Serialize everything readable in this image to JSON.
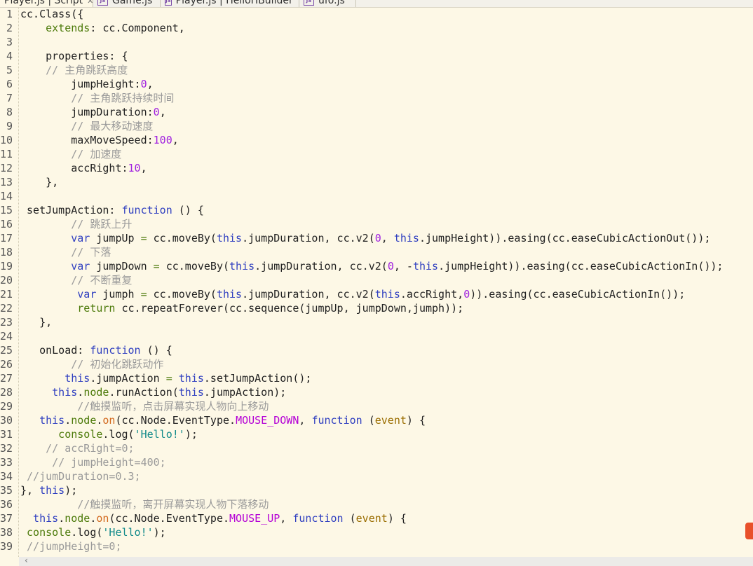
{
  "tabs": [
    {
      "label": "Player.js | Script",
      "active": true,
      "icon": "js-file-icon"
    },
    {
      "label": "Game.js",
      "icon": "js-file-icon"
    },
    {
      "label": "Player.js | HelloHBuilder",
      "icon": "js-file-icon"
    },
    {
      "label": "ufo.js",
      "icon": "js-file-icon"
    }
  ],
  "tab_icon_text": "JS",
  "tab_close": "✕",
  "scroll_left": "‹",
  "colors": {
    "background": "#fdf8e6",
    "keyword": "#2f3fc0",
    "number": "#a020e0",
    "string": "#118a8a",
    "comment": "#9a9a9a"
  },
  "code": {
    "lines": [
      {
        "n": "1",
        "t": [
          [
            "p",
            "cc.Class({"
          ]
        ]
      },
      {
        "n": "2",
        "t": [
          [
            "p",
            "    "
          ],
          [
            "g",
            "extends"
          ],
          [
            "p",
            ": cc.Component,"
          ]
        ]
      },
      {
        "n": "3",
        "t": []
      },
      {
        "n": "4",
        "t": [
          [
            "p",
            "    properties: {"
          ]
        ]
      },
      {
        "n": "5",
        "t": [
          [
            "c",
            "    // 主角跳跃高度"
          ]
        ]
      },
      {
        "n": "6",
        "t": [
          [
            "p",
            "        jumpHeight:"
          ],
          [
            "n",
            "0"
          ],
          [
            "p",
            ","
          ]
        ]
      },
      {
        "n": "7",
        "t": [
          [
            "c",
            "        // 主角跳跃持续时间"
          ]
        ]
      },
      {
        "n": "8",
        "t": [
          [
            "p",
            "        jumpDuration:"
          ],
          [
            "n",
            "0"
          ],
          [
            "p",
            ","
          ]
        ]
      },
      {
        "n": "9",
        "t": [
          [
            "c",
            "        // 最大移动速度"
          ]
        ]
      },
      {
        "n": "10",
        "t": [
          [
            "p",
            "        maxMoveSpeed:"
          ],
          [
            "n",
            "100"
          ],
          [
            "p",
            ","
          ]
        ]
      },
      {
        "n": "11",
        "t": [
          [
            "c",
            "        // 加速度"
          ]
        ]
      },
      {
        "n": "12",
        "t": [
          [
            "p",
            "        accRight:"
          ],
          [
            "n",
            "10"
          ],
          [
            "p",
            ","
          ]
        ]
      },
      {
        "n": "13",
        "t": [
          [
            "p",
            "    },"
          ]
        ]
      },
      {
        "n": "14",
        "t": []
      },
      {
        "n": "15",
        "t": [
          [
            "p",
            " setJumpAction: "
          ],
          [
            "k",
            "function"
          ],
          [
            "p",
            " () {"
          ]
        ]
      },
      {
        "n": "16",
        "t": [
          [
            "c",
            "        // 跳跃上升"
          ]
        ]
      },
      {
        "n": "17",
        "t": [
          [
            "k",
            "        var"
          ],
          [
            "p",
            " jumpUp "
          ],
          [
            "g",
            "="
          ],
          [
            "p",
            " cc.moveBy("
          ],
          [
            "k",
            "this"
          ],
          [
            "p",
            ".jumpDuration, cc.v2("
          ],
          [
            "n",
            "0"
          ],
          [
            "p",
            ", "
          ],
          [
            "k",
            "this"
          ],
          [
            "p",
            ".jumpHeight)).easing(cc.easeCubicActionOut());"
          ]
        ]
      },
      {
        "n": "18",
        "t": [
          [
            "c",
            "        // 下落"
          ]
        ]
      },
      {
        "n": "19",
        "t": [
          [
            "k",
            "        var"
          ],
          [
            "p",
            " jumpDown "
          ],
          [
            "g",
            "="
          ],
          [
            "p",
            " cc.moveBy("
          ],
          [
            "k",
            "this"
          ],
          [
            "p",
            ".jumpDuration, cc.v2("
          ],
          [
            "n",
            "0"
          ],
          [
            "p",
            ", -"
          ],
          [
            "k",
            "this"
          ],
          [
            "p",
            ".jumpHeight)).easing(cc.easeCubicActionIn());"
          ]
        ]
      },
      {
        "n": "20",
        "t": [
          [
            "c",
            "        // 不断重复"
          ]
        ]
      },
      {
        "n": "21",
        "t": [
          [
            "k",
            "         var"
          ],
          [
            "p",
            " jumph "
          ],
          [
            "g",
            "="
          ],
          [
            "p",
            " cc.moveBy("
          ],
          [
            "k",
            "this"
          ],
          [
            "p",
            ".jumpDuration, cc.v2("
          ],
          [
            "k",
            "this"
          ],
          [
            "p",
            ".accRight,"
          ],
          [
            "n",
            "0"
          ],
          [
            "p",
            ")).easing(cc.easeCubicActionIn());"
          ]
        ]
      },
      {
        "n": "22",
        "t": [
          [
            "g",
            "         return"
          ],
          [
            "p",
            " cc.repeatForever(cc.sequence(jumpUp, jumpDown,jumph));"
          ]
        ]
      },
      {
        "n": "23",
        "t": [
          [
            "p",
            "   },"
          ]
        ]
      },
      {
        "n": "24",
        "t": []
      },
      {
        "n": "25",
        "t": [
          [
            "p",
            "   onLoad: "
          ],
          [
            "k",
            "function"
          ],
          [
            "p",
            " () {"
          ]
        ]
      },
      {
        "n": "26",
        "t": [
          [
            "c",
            "        // 初始化跳跃动作"
          ]
        ]
      },
      {
        "n": "27",
        "t": [
          [
            "k",
            "       this"
          ],
          [
            "p",
            ".jumpAction "
          ],
          [
            "g",
            "="
          ],
          [
            "p",
            " "
          ],
          [
            "k",
            "this"
          ],
          [
            "p",
            ".setJumpAction();"
          ]
        ]
      },
      {
        "n": "28",
        "t": [
          [
            "k",
            "     this"
          ],
          [
            "p",
            "."
          ],
          [
            "g",
            "node"
          ],
          [
            "p",
            ".runAction("
          ],
          [
            "k",
            "this"
          ],
          [
            "p",
            ".jumpAction);"
          ]
        ]
      },
      {
        "n": "29",
        "t": [
          [
            "c",
            "         //触摸监听，点击屏幕实现人物向上移动"
          ]
        ]
      },
      {
        "n": "30",
        "t": [
          [
            "k",
            "   this"
          ],
          [
            "p",
            "."
          ],
          [
            "g",
            "node"
          ],
          [
            "p",
            "."
          ],
          [
            "o",
            "on"
          ],
          [
            "p",
            "(cc.Node.EventType."
          ],
          [
            "m",
            "MOUSE_DOWN"
          ],
          [
            "p",
            ", "
          ],
          [
            "k",
            "function"
          ],
          [
            "p",
            " ("
          ],
          [
            "e",
            "event"
          ],
          [
            "p",
            ") {"
          ]
        ]
      },
      {
        "n": "31",
        "t": [
          [
            "g",
            "      console"
          ],
          [
            "p",
            ".log("
          ],
          [
            "s",
            "'Hello!'"
          ],
          [
            "p",
            ");"
          ]
        ]
      },
      {
        "n": "32",
        "t": [
          [
            "c",
            "    // accRight=0;"
          ]
        ]
      },
      {
        "n": "33",
        "t": [
          [
            "c",
            "     // jumpHeight=400;"
          ]
        ]
      },
      {
        "n": "34",
        "t": [
          [
            "c",
            " //jumDuration=0.3;"
          ]
        ]
      },
      {
        "n": "35",
        "t": [
          [
            "p",
            "}, "
          ],
          [
            "k",
            "this"
          ],
          [
            "p",
            ");"
          ]
        ]
      },
      {
        "n": "36",
        "t": [
          [
            "c",
            "         //触摸监听，离开屏幕实现人物下落移动"
          ]
        ]
      },
      {
        "n": "37",
        "t": [
          [
            "k",
            "  this"
          ],
          [
            "p",
            "."
          ],
          [
            "g",
            "node"
          ],
          [
            "p",
            "."
          ],
          [
            "o",
            "on"
          ],
          [
            "p",
            "(cc.Node.EventType."
          ],
          [
            "m",
            "MOUSE_UP"
          ],
          [
            "p",
            ", "
          ],
          [
            "k",
            "function"
          ],
          [
            "p",
            " ("
          ],
          [
            "e",
            "event"
          ],
          [
            "p",
            ") {"
          ]
        ]
      },
      {
        "n": "38",
        "t": [
          [
            "g",
            " console"
          ],
          [
            "p",
            ".log("
          ],
          [
            "s",
            "'Hello!'"
          ],
          [
            "p",
            ");"
          ]
        ]
      },
      {
        "n": "39",
        "t": [
          [
            "c",
            " //jumpHeight=0;"
          ]
        ]
      }
    ]
  }
}
